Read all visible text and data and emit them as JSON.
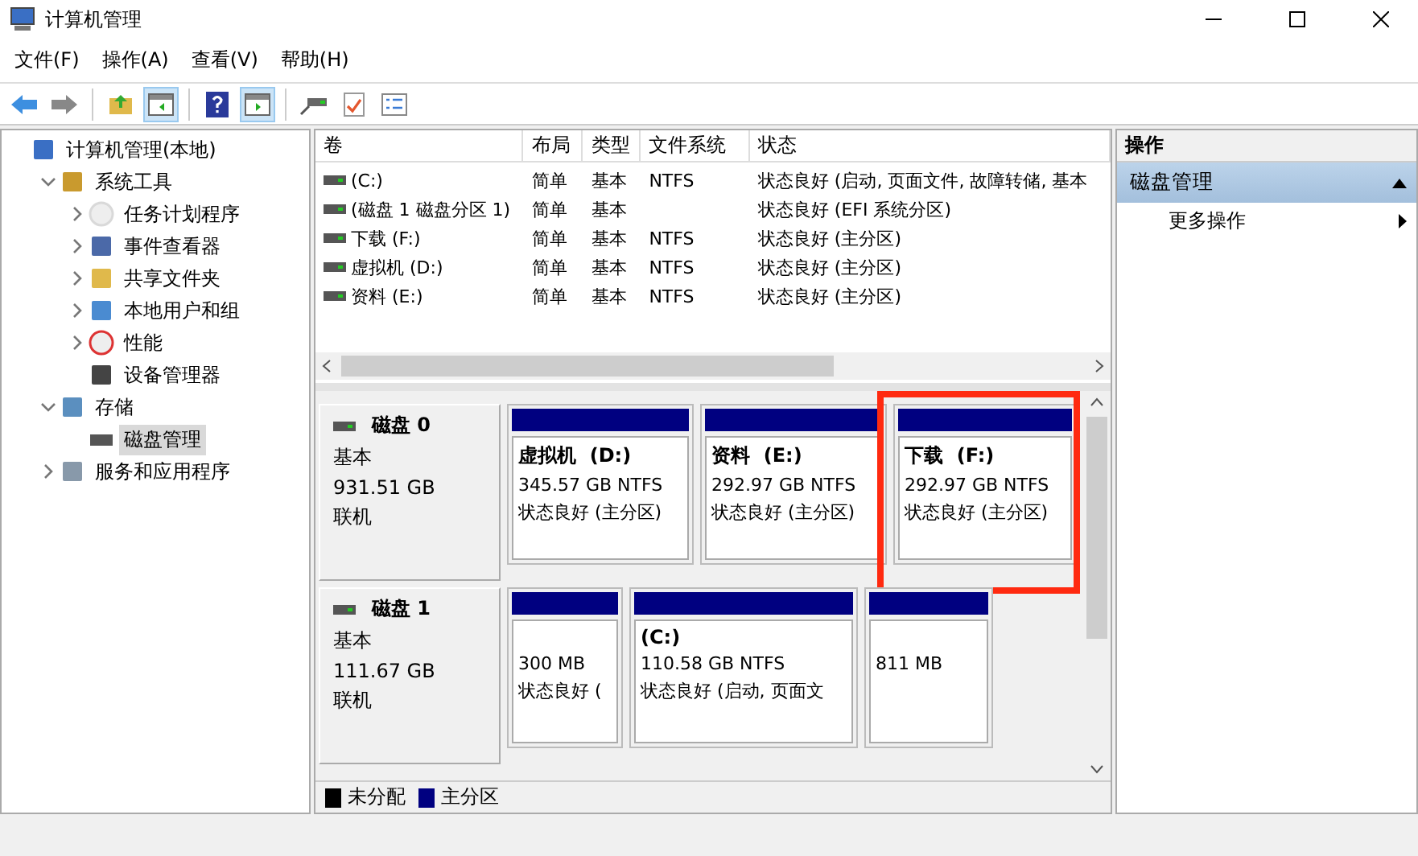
{
  "window": {
    "title": "计算机管理"
  },
  "menu": [
    "文件(F)",
    "操作(A)",
    "查看(V)",
    "帮助(H)"
  ],
  "toolbar": [
    {
      "kind": "back"
    },
    {
      "kind": "forward"
    },
    {
      "kind": "sep"
    },
    {
      "kind": "up",
      "selected": false
    },
    {
      "kind": "pane-left",
      "selected": true
    },
    {
      "kind": "sep"
    },
    {
      "kind": "help",
      "selected": false
    },
    {
      "kind": "pane-right",
      "selected": true
    },
    {
      "kind": "sep"
    },
    {
      "kind": "connect"
    },
    {
      "kind": "check"
    },
    {
      "kind": "list"
    }
  ],
  "tree": [
    {
      "label": "计算机管理(本地)",
      "selected": false,
      "children": [
        {
          "label": "系统工具",
          "expanded": true,
          "selected": false,
          "children": [
            {
              "label": "任务计划程序",
              "expanded": false,
              "selected": false
            },
            {
              "label": "事件查看器",
              "expanded": false,
              "selected": false
            },
            {
              "label": "共享文件夹",
              "expanded": false,
              "selected": false
            },
            {
              "label": "本地用户和组",
              "expanded": false,
              "selected": false
            },
            {
              "label": "性能",
              "expanded": false,
              "selected": false
            },
            {
              "label": "设备管理器",
              "selected": false
            }
          ]
        },
        {
          "label": "存储",
          "expanded": true,
          "selected": false,
          "children": [
            {
              "label": "磁盘管理",
              "selected": true
            }
          ]
        },
        {
          "label": "服务和应用程序",
          "expanded": false,
          "selected": false
        }
      ]
    }
  ],
  "table": {
    "columns": [
      "卷",
      "布局",
      "类型",
      "文件系统",
      "状态"
    ],
    "rows": [
      {
        "cells": [
          " (C:)",
          "简单",
          "基本",
          "NTFS",
          "状态良好 (启动, 页面文件, 故障转储, 基本"
        ]
      },
      {
        "cells": [
          "(磁盘 1 磁盘分区 1)",
          "简单",
          "基本",
          "",
          "状态良好 (EFI 系统分区)"
        ]
      },
      {
        "cells": [
          "下载 (F:)",
          "简单",
          "基本",
          "NTFS",
          "状态良好 (主分区)"
        ]
      },
      {
        "cells": [
          "虚拟机 (D:)",
          "简单",
          "基本",
          "NTFS",
          "状态良好 (主分区)"
        ]
      },
      {
        "cells": [
          "资料 (E:)",
          "简单",
          "基本",
          "NTFS",
          "状态良好 (主分区)"
        ]
      }
    ]
  },
  "disks": [
    {
      "name": "磁盘 0",
      "type": "基本",
      "size": "931.51 GB",
      "status": "联机",
      "partitions": [
        {
          "kind": "primary",
          "name": "虚拟机  (D:)",
          "size": "345.57 GB NTFS",
          "status": "状态良好 (主分区)",
          "highlighted": false
        },
        {
          "kind": "primary",
          "name": "资料  (E:)",
          "size": "292.97 GB NTFS",
          "status": "状态良好 (主分区)",
          "highlighted": false
        },
        {
          "kind": "primary",
          "name": "下载  (F:)",
          "size": "292.97 GB NTFS",
          "status": "状态良好 (主分区)",
          "highlighted": true
        }
      ]
    },
    {
      "name": "磁盘 1",
      "type": "基本",
      "size": "111.67 GB",
      "status": "联机",
      "partitions": [
        {
          "kind": "primary",
          "size": "300 MB",
          "status": "状态良好 (",
          "highlighted": false
        },
        {
          "kind": "primary",
          "name": "(C:)",
          "size": "110.58 GB NTFS",
          "status": "状态良好 (启动, 页面文",
          "highlighted": false
        },
        {
          "kind": "primary",
          "size": "811 MB",
          "highlighted": false
        }
      ]
    }
  ],
  "legend": [
    {
      "kind": "unallocated",
      "label": "未分配",
      "color": "#000000"
    },
    {
      "kind": "primary",
      "label": "主分区",
      "color": "#000080"
    }
  ],
  "actions": {
    "title": "操作",
    "group": {
      "label": "磁盘管理",
      "expanded": true
    },
    "items": [
      "更多操作"
    ]
  }
}
